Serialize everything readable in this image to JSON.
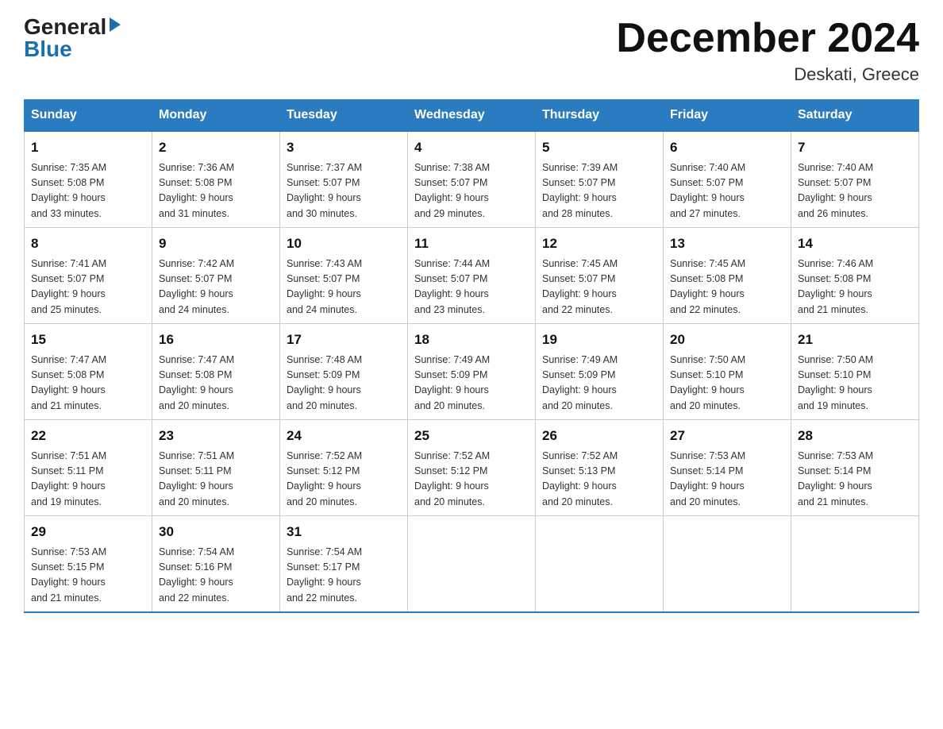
{
  "header": {
    "logo_general": "General",
    "logo_blue": "Blue",
    "month_title": "December 2024",
    "location": "Deskati, Greece"
  },
  "days_of_week": [
    "Sunday",
    "Monday",
    "Tuesday",
    "Wednesday",
    "Thursday",
    "Friday",
    "Saturday"
  ],
  "weeks": [
    [
      {
        "day": "1",
        "sunrise": "Sunrise: 7:35 AM",
        "sunset": "Sunset: 5:08 PM",
        "daylight": "Daylight: 9 hours",
        "daylight2": "and 33 minutes."
      },
      {
        "day": "2",
        "sunrise": "Sunrise: 7:36 AM",
        "sunset": "Sunset: 5:08 PM",
        "daylight": "Daylight: 9 hours",
        "daylight2": "and 31 minutes."
      },
      {
        "day": "3",
        "sunrise": "Sunrise: 7:37 AM",
        "sunset": "Sunset: 5:07 PM",
        "daylight": "Daylight: 9 hours",
        "daylight2": "and 30 minutes."
      },
      {
        "day": "4",
        "sunrise": "Sunrise: 7:38 AM",
        "sunset": "Sunset: 5:07 PM",
        "daylight": "Daylight: 9 hours",
        "daylight2": "and 29 minutes."
      },
      {
        "day": "5",
        "sunrise": "Sunrise: 7:39 AM",
        "sunset": "Sunset: 5:07 PM",
        "daylight": "Daylight: 9 hours",
        "daylight2": "and 28 minutes."
      },
      {
        "day": "6",
        "sunrise": "Sunrise: 7:40 AM",
        "sunset": "Sunset: 5:07 PM",
        "daylight": "Daylight: 9 hours",
        "daylight2": "and 27 minutes."
      },
      {
        "day": "7",
        "sunrise": "Sunrise: 7:40 AM",
        "sunset": "Sunset: 5:07 PM",
        "daylight": "Daylight: 9 hours",
        "daylight2": "and 26 minutes."
      }
    ],
    [
      {
        "day": "8",
        "sunrise": "Sunrise: 7:41 AM",
        "sunset": "Sunset: 5:07 PM",
        "daylight": "Daylight: 9 hours",
        "daylight2": "and 25 minutes."
      },
      {
        "day": "9",
        "sunrise": "Sunrise: 7:42 AM",
        "sunset": "Sunset: 5:07 PM",
        "daylight": "Daylight: 9 hours",
        "daylight2": "and 24 minutes."
      },
      {
        "day": "10",
        "sunrise": "Sunrise: 7:43 AM",
        "sunset": "Sunset: 5:07 PM",
        "daylight": "Daylight: 9 hours",
        "daylight2": "and 24 minutes."
      },
      {
        "day": "11",
        "sunrise": "Sunrise: 7:44 AM",
        "sunset": "Sunset: 5:07 PM",
        "daylight": "Daylight: 9 hours",
        "daylight2": "and 23 minutes."
      },
      {
        "day": "12",
        "sunrise": "Sunrise: 7:45 AM",
        "sunset": "Sunset: 5:07 PM",
        "daylight": "Daylight: 9 hours",
        "daylight2": "and 22 minutes."
      },
      {
        "day": "13",
        "sunrise": "Sunrise: 7:45 AM",
        "sunset": "Sunset: 5:08 PM",
        "daylight": "Daylight: 9 hours",
        "daylight2": "and 22 minutes."
      },
      {
        "day": "14",
        "sunrise": "Sunrise: 7:46 AM",
        "sunset": "Sunset: 5:08 PM",
        "daylight": "Daylight: 9 hours",
        "daylight2": "and 21 minutes."
      }
    ],
    [
      {
        "day": "15",
        "sunrise": "Sunrise: 7:47 AM",
        "sunset": "Sunset: 5:08 PM",
        "daylight": "Daylight: 9 hours",
        "daylight2": "and 21 minutes."
      },
      {
        "day": "16",
        "sunrise": "Sunrise: 7:47 AM",
        "sunset": "Sunset: 5:08 PM",
        "daylight": "Daylight: 9 hours",
        "daylight2": "and 20 minutes."
      },
      {
        "day": "17",
        "sunrise": "Sunrise: 7:48 AM",
        "sunset": "Sunset: 5:09 PM",
        "daylight": "Daylight: 9 hours",
        "daylight2": "and 20 minutes."
      },
      {
        "day": "18",
        "sunrise": "Sunrise: 7:49 AM",
        "sunset": "Sunset: 5:09 PM",
        "daylight": "Daylight: 9 hours",
        "daylight2": "and 20 minutes."
      },
      {
        "day": "19",
        "sunrise": "Sunrise: 7:49 AM",
        "sunset": "Sunset: 5:09 PM",
        "daylight": "Daylight: 9 hours",
        "daylight2": "and 20 minutes."
      },
      {
        "day": "20",
        "sunrise": "Sunrise: 7:50 AM",
        "sunset": "Sunset: 5:10 PM",
        "daylight": "Daylight: 9 hours",
        "daylight2": "and 20 minutes."
      },
      {
        "day": "21",
        "sunrise": "Sunrise: 7:50 AM",
        "sunset": "Sunset: 5:10 PM",
        "daylight": "Daylight: 9 hours",
        "daylight2": "and 19 minutes."
      }
    ],
    [
      {
        "day": "22",
        "sunrise": "Sunrise: 7:51 AM",
        "sunset": "Sunset: 5:11 PM",
        "daylight": "Daylight: 9 hours",
        "daylight2": "and 19 minutes."
      },
      {
        "day": "23",
        "sunrise": "Sunrise: 7:51 AM",
        "sunset": "Sunset: 5:11 PM",
        "daylight": "Daylight: 9 hours",
        "daylight2": "and 20 minutes."
      },
      {
        "day": "24",
        "sunrise": "Sunrise: 7:52 AM",
        "sunset": "Sunset: 5:12 PM",
        "daylight": "Daylight: 9 hours",
        "daylight2": "and 20 minutes."
      },
      {
        "day": "25",
        "sunrise": "Sunrise: 7:52 AM",
        "sunset": "Sunset: 5:12 PM",
        "daylight": "Daylight: 9 hours",
        "daylight2": "and 20 minutes."
      },
      {
        "day": "26",
        "sunrise": "Sunrise: 7:52 AM",
        "sunset": "Sunset: 5:13 PM",
        "daylight": "Daylight: 9 hours",
        "daylight2": "and 20 minutes."
      },
      {
        "day": "27",
        "sunrise": "Sunrise: 7:53 AM",
        "sunset": "Sunset: 5:14 PM",
        "daylight": "Daylight: 9 hours",
        "daylight2": "and 20 minutes."
      },
      {
        "day": "28",
        "sunrise": "Sunrise: 7:53 AM",
        "sunset": "Sunset: 5:14 PM",
        "daylight": "Daylight: 9 hours",
        "daylight2": "and 21 minutes."
      }
    ],
    [
      {
        "day": "29",
        "sunrise": "Sunrise: 7:53 AM",
        "sunset": "Sunset: 5:15 PM",
        "daylight": "Daylight: 9 hours",
        "daylight2": "and 21 minutes."
      },
      {
        "day": "30",
        "sunrise": "Sunrise: 7:54 AM",
        "sunset": "Sunset: 5:16 PM",
        "daylight": "Daylight: 9 hours",
        "daylight2": "and 22 minutes."
      },
      {
        "day": "31",
        "sunrise": "Sunrise: 7:54 AM",
        "sunset": "Sunset: 5:17 PM",
        "daylight": "Daylight: 9 hours",
        "daylight2": "and 22 minutes."
      },
      null,
      null,
      null,
      null
    ]
  ]
}
